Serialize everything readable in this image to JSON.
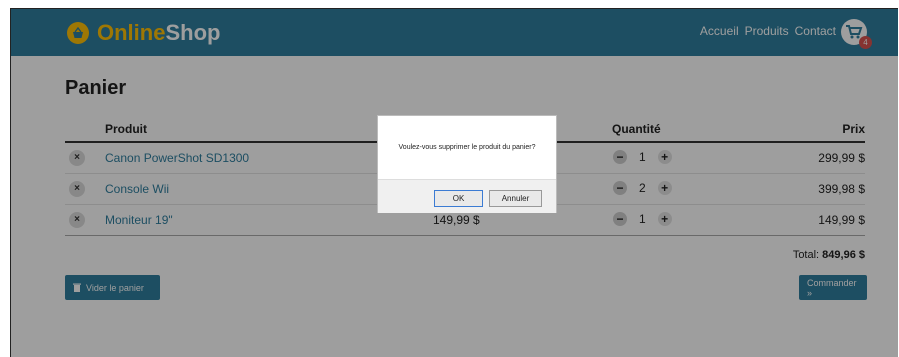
{
  "brand": {
    "online": "Online",
    "shop": "Shop"
  },
  "nav": {
    "links": [
      "Accueil",
      "Produits",
      "Contact"
    ],
    "cart_count": "4"
  },
  "page": {
    "title": "Panier"
  },
  "table": {
    "headers": {
      "product": "Produit",
      "quantity": "Quantité",
      "price": "Prix"
    },
    "rows": [
      {
        "remove": "×",
        "name": "Canon PowerShot SD1300",
        "unit_price": "",
        "qty": "1",
        "price": "299,99 $"
      },
      {
        "remove": "×",
        "name": "Console Wii",
        "unit_price": "",
        "qty": "2",
        "price": "399,98 $"
      },
      {
        "remove": "×",
        "name": "Moniteur 19\"",
        "unit_price": "149,99 $",
        "qty": "1",
        "price": "149,99 $"
      }
    ]
  },
  "summary": {
    "total_label": "Total:",
    "total_value": "849,96 $"
  },
  "actions": {
    "clear": "Vider le panier",
    "order": "Commander »"
  },
  "dialog": {
    "message": "Voulez-vous supprimer le produit du panier?",
    "ok": "OK",
    "cancel": "Annuler"
  },
  "colors": {
    "primary": "#2f7f9f",
    "accent": "#ffc107",
    "badge": "#d9534f"
  }
}
